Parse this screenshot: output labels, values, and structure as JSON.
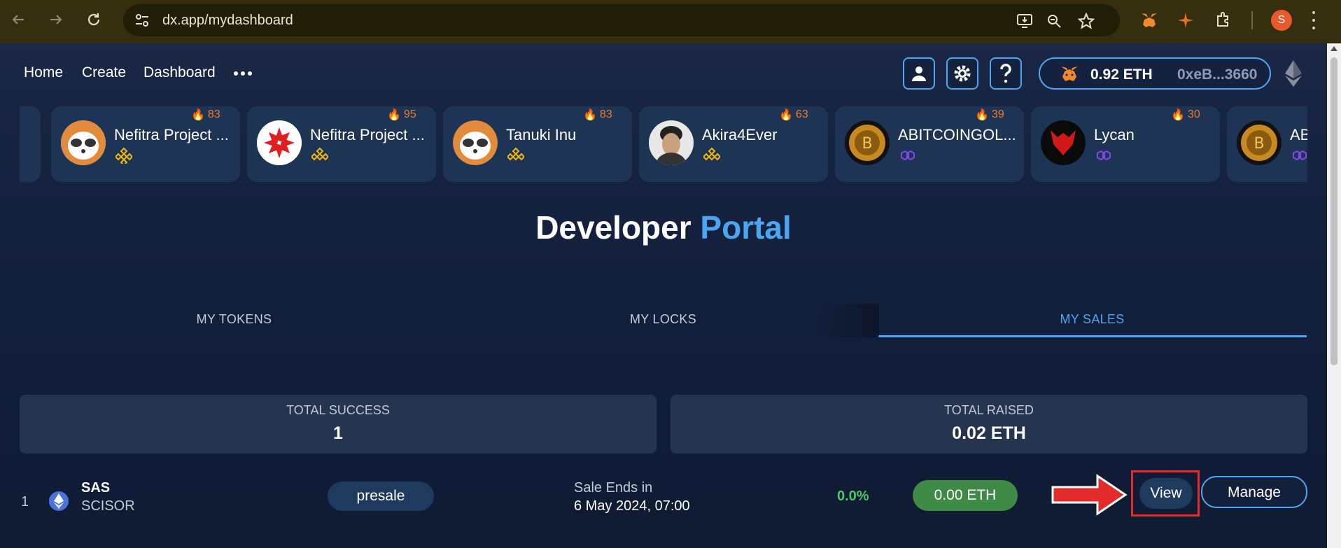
{
  "browser": {
    "url": "dx.app/mydashboard",
    "profile_initial": "S"
  },
  "nav": {
    "home": "Home",
    "create": "Create",
    "dashboard": "Dashboard"
  },
  "wallet": {
    "balance": "0.92 ETH",
    "address": "0xeB...3660"
  },
  "trending": [
    {
      "name": "Tanuki Inu",
      "score": "83",
      "chain": "bnb"
    },
    {
      "name": "Nefitra Project ...",
      "score": "95",
      "chain": "bnb"
    },
    {
      "name": "Tanuki Inu",
      "score": "83",
      "chain": "bnb"
    },
    {
      "name": "Akira4Ever",
      "score": "63",
      "chain": "bnb"
    },
    {
      "name": "ABITCOINGOL...",
      "score": "39",
      "chain": "polygon"
    },
    {
      "name": "Lycan",
      "score": "30",
      "chain": "polygon"
    },
    {
      "name": "AB",
      "score": "",
      "chain": "polygon"
    }
  ],
  "title": {
    "part1": "Developer",
    "part2": "Portal"
  },
  "tabs": [
    {
      "label": "MY TOKENS",
      "active": false
    },
    {
      "label": "MY LOCKS",
      "active": false
    },
    {
      "label": "MY SALES",
      "active": true
    }
  ],
  "stats": {
    "success_label": "TOTAL SUCCESS",
    "success_value": "1",
    "raised_label": "TOTAL RAISED",
    "raised_value": "0.02 ETH"
  },
  "sale_row": {
    "index": "1",
    "symbol": "SAS",
    "name": "SCISOR",
    "type": "presale",
    "ends_label": "Sale Ends in",
    "ends_value": "6 May 2024, 07:00",
    "percent": "0.0%",
    "raised": "0.00 ETH",
    "view_label": "View",
    "manage_label": "Manage"
  },
  "colors": {
    "accent": "#4aa6f1",
    "success": "#4cc46a",
    "fire": "#f07b2a",
    "annotation": "#e32b2b"
  }
}
